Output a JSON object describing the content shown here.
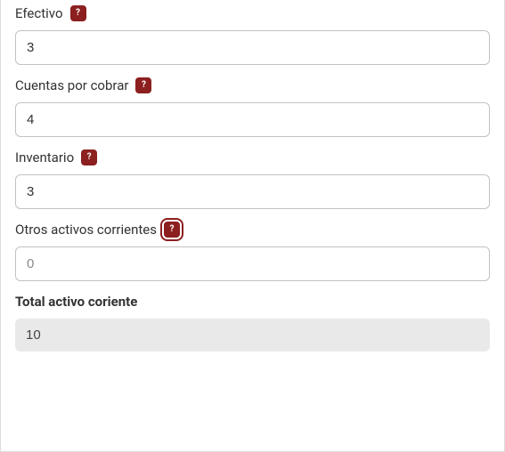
{
  "fields": {
    "efectivo": {
      "label": "Efectivo",
      "value": "3",
      "help": "?"
    },
    "cuentas": {
      "label": "Cuentas por cobrar",
      "value": "4",
      "help": "?"
    },
    "inventario": {
      "label": "Inventario",
      "value": "3",
      "help": "?"
    },
    "otros": {
      "label": "Otros activos corrientes",
      "placeholder": "0",
      "help": "?"
    }
  },
  "total": {
    "label": "Total activo coriente",
    "value": "10"
  }
}
